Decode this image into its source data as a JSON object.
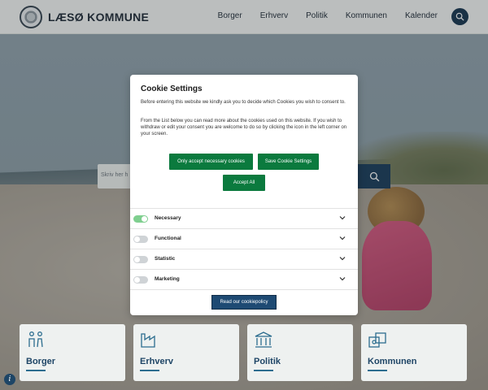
{
  "header": {
    "brand": "LÆSØ KOMMUNE",
    "nav": [
      "Borger",
      "Erhverv",
      "Politik",
      "Kommunen",
      "Kalender"
    ],
    "search_icon": "search-icon"
  },
  "hero": {
    "search_placeholder": "Skriv her h"
  },
  "cookie_modal": {
    "title": "Cookie Settings",
    "intro": "Before entering this website we kindly ask you to decide which Cookies you wish to consent to.",
    "details": "From the List below you can read more about the cookies used on this website. If you wish to withdraw or edit your consent you are welcome to do so by clicking the icon in the left corner on your screen.",
    "btn_necessary": "Only accept necessary cookies",
    "btn_save": "Save Cookie Settings",
    "btn_accept": "Accept All",
    "categories": [
      {
        "label": "Necessary",
        "enabled": true
      },
      {
        "label": "Functional",
        "enabled": false
      },
      {
        "label": "Statistic",
        "enabled": false
      },
      {
        "label": "Marketing",
        "enabled": false
      }
    ],
    "btn_read": "Read our cookiepolicy"
  },
  "cards": [
    {
      "title": "Borger",
      "icon": "people-icon"
    },
    {
      "title": "Erhverv",
      "icon": "factory-icon"
    },
    {
      "title": "Politik",
      "icon": "town-hall-icon"
    },
    {
      "title": "Kommunen",
      "icon": "municipality-icon"
    }
  ],
  "colors": {
    "primary_dark": "#14324d",
    "accept_green": "#0b7a3e",
    "card_title": "#1e4566"
  }
}
